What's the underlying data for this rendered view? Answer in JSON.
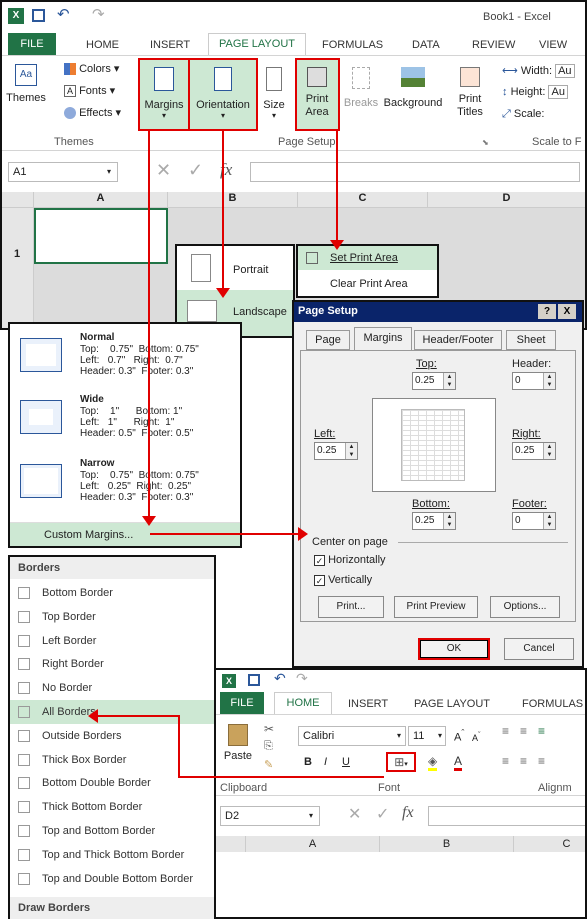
{
  "title_bar": {
    "title": "Book1 - Excel"
  },
  "ribbon_top": {
    "tabs": [
      "FILE",
      "HOME",
      "INSERT",
      "PAGE LAYOUT",
      "FORMULAS",
      "DATA",
      "REVIEW",
      "VIEW"
    ],
    "themes": {
      "label": "Themes",
      "colors": "Colors",
      "fonts": "Fonts",
      "effects": "Effects",
      "group": "Themes"
    },
    "buttons": {
      "margins": "Margins",
      "orientation": "Orientation",
      "size": "Size",
      "print_area": "Print Area",
      "breaks": "Breaks",
      "background": "Background",
      "print_titles": "Print Titles"
    },
    "group_page_setup": "Page Setup",
    "scale": {
      "width": "Width:",
      "height": "Height:",
      "scale": "Scale:",
      "width_val": "Au",
      "height_val": "Au",
      "group": "Scale to F"
    }
  },
  "formula_bar": {
    "cell": "A1",
    "fx": "fx"
  },
  "grid_top": {
    "columns": [
      "A",
      "B",
      "C",
      "D"
    ],
    "row": "1"
  },
  "orientation_menu": {
    "portrait": "Portrait",
    "landscape": "Landscape"
  },
  "print_area_menu": {
    "set": "Set Print Area",
    "clear": "Clear Print Area"
  },
  "margins_menu": {
    "presets": [
      {
        "name": "Normal",
        "l1": "Top:    0.75\"  Bottom: 0.75\"",
        "l2": "Left:   0.7\"   Right:  0.7\"",
        "l3": "Header: 0.3\"  Footer: 0.3\""
      },
      {
        "name": "Wide",
        "l1": "Top:    1\"      Bottom: 1\"",
        "l2": "Left:   1\"      Right:  1\"",
        "l3": "Header: 0.5\"  Footer: 0.5\""
      },
      {
        "name": "Narrow",
        "l1": "Top:    0.75\"  Bottom: 0.75\"",
        "l2": "Left:   0.25\"  Right:  0.25\"",
        "l3": "Header: 0.3\"  Footer: 0.3\""
      }
    ],
    "custom": "Custom Margins..."
  },
  "page_setup": {
    "title": "Page Setup",
    "help": "?",
    "close": "X",
    "tabs": [
      "Page",
      "Margins",
      "Header/Footer",
      "Sheet"
    ],
    "top_label": "Top:",
    "top": "0.25",
    "header_label": "Header:",
    "header": "0",
    "left_label": "Left:",
    "left": "0.25",
    "right_label": "Right:",
    "right": "0.25",
    "bottom_label": "Bottom:",
    "bottom": "0.25",
    "footer_label": "Footer:",
    "footer": "0",
    "center_label": "Center on page",
    "horiz": "Horizontally",
    "vert": "Vertically",
    "print": "Print...",
    "preview": "Print Preview",
    "options": "Options...",
    "ok": "OK",
    "cancel": "Cancel"
  },
  "borders_menu": {
    "header": "Borders",
    "items": [
      "Bottom Border",
      "Top Border",
      "Left Border",
      "Right Border",
      "No Border",
      "All Borders",
      "Outside Borders",
      "Thick Box Border",
      "Bottom Double Border",
      "Thick Bottom Border",
      "Top and Bottom Border",
      "Top and Thick Bottom Border",
      "Top and Double Bottom Border"
    ],
    "footer": "Draw Borders"
  },
  "ribbon_bottom": {
    "tabs": [
      "FILE",
      "HOME",
      "INSERT",
      "PAGE LAYOUT",
      "FORMULAS"
    ],
    "paste": "Paste",
    "clipboard": "Clipboard",
    "font_name": "Calibri",
    "font_size": "11",
    "font_group": "Font",
    "align": "Alignm",
    "bold": "B",
    "italic": "I",
    "underline": "U"
  },
  "formula_bar2": {
    "cell": "D2",
    "fx": "fx"
  },
  "grid_bottom": {
    "columns": [
      "A",
      "B",
      "C"
    ]
  },
  "colors": {
    "accent": "#217346",
    "highlight": "#e00000",
    "selected_bg": "#cde8d3"
  }
}
